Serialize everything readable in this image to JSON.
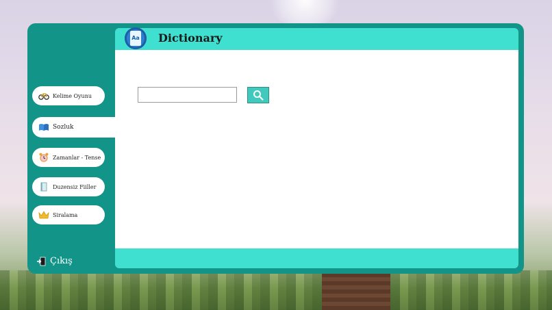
{
  "app": {
    "title": "Dictionary"
  },
  "search": {
    "value": "",
    "placeholder": ""
  },
  "sidebar": {
    "items": [
      {
        "label": "Kelime Oyunu",
        "icon": "bicycle-icon"
      },
      {
        "label": "Sozluk",
        "icon": "book-icon"
      },
      {
        "label": "Zamanlar - Tense",
        "icon": "alarm-clock-icon"
      },
      {
        "label": "Duzensiz Fiiller",
        "icon": "notebook-icon"
      },
      {
        "label": "Siralama",
        "icon": "crown-icon"
      }
    ],
    "active_index": 1,
    "exit_label": "Çıkış"
  },
  "colors": {
    "frame": "#129488",
    "header": "#40e0d0",
    "content": "#ffffff",
    "search_button": "#40c9bc"
  }
}
